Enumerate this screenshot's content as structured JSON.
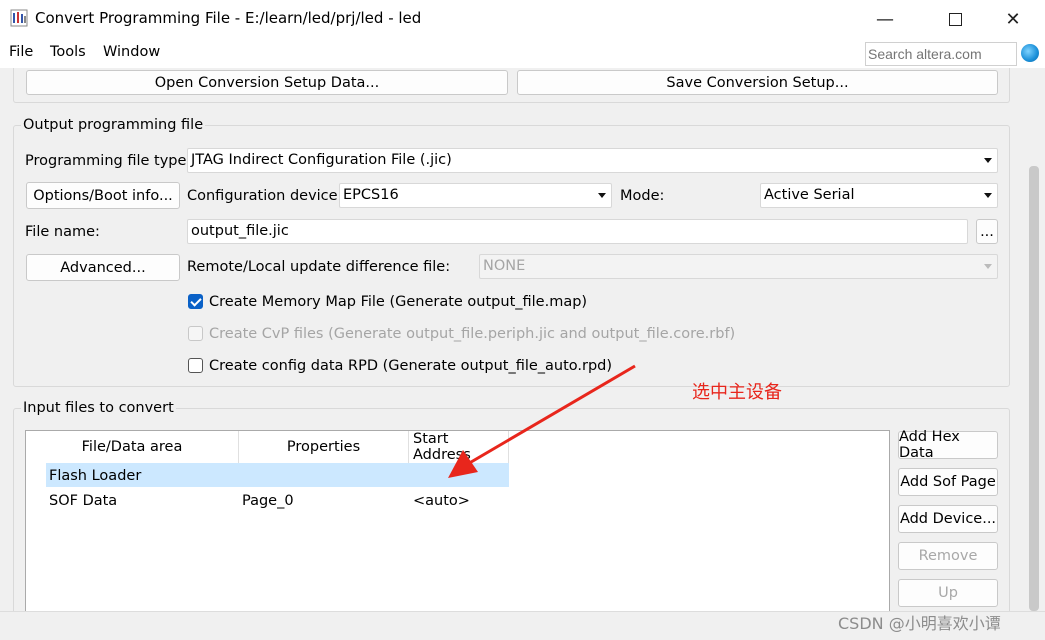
{
  "window": {
    "title": "Convert Programming File - E:/learn/led/prj/led - led"
  },
  "menu": {
    "file_label": "File",
    "tools_label": "Tools",
    "window_label": "Window"
  },
  "search": {
    "placeholder": "Search altera.com"
  },
  "top_buttons": {
    "open_label": "Open Conversion Setup Data...",
    "save_label": "Save Conversion Setup..."
  },
  "output_group": {
    "title": "Output programming file",
    "file_type_label": "Programming file type:",
    "file_type_value": "JTAG Indirect Configuration File (.jic)",
    "options_button": "Options/Boot info...",
    "config_device_label": "Configuration device:",
    "config_device_value": "EPCS16",
    "mode_label": "Mode:",
    "mode_value": "Active Serial",
    "file_name_label": "File name:",
    "file_name_value": "output_file.jic",
    "browse_button": "...",
    "advanced_button": "Advanced...",
    "remote_label": "Remote/Local update difference file:",
    "remote_value": "NONE",
    "memory_map_label": "Create Memory Map File (Generate output_file.map)",
    "memory_map_checked": true,
    "cvp_label": "Create CvP files (Generate output_file.periph.jic and output_file.core.rbf)",
    "cvp_checked": false,
    "rpd_label": "Create config data RPD (Generate output_file_auto.rpd)",
    "rpd_checked": false
  },
  "input_group": {
    "title": "Input files to convert",
    "columns": [
      "File/Data area",
      "Properties",
      "Start Address"
    ],
    "rows": [
      {
        "file": "Flash Loader",
        "properties": "",
        "start": ""
      },
      {
        "file": "SOF Data",
        "properties": "Page_0",
        "start": "<auto>"
      }
    ],
    "buttons": {
      "add_hex": "Add Hex Data",
      "add_sof": "Add Sof Page",
      "add_device": "Add Device...",
      "remove": "Remove",
      "up": "Up"
    }
  },
  "annotation": {
    "text": "选中主设备",
    "color": "#e8261c"
  },
  "watermark": {
    "text": "CSDN @小明喜欢小谭"
  },
  "colors": {
    "selection": "#cce8ff",
    "checkbox_accent": "#0a61c7"
  }
}
